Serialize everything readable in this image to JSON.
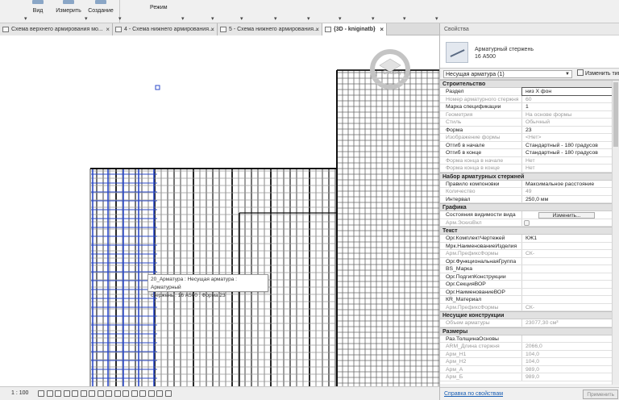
{
  "ribbon": {
    "buttons": [
      {
        "label": "Вид",
        "icon": "view-icon"
      },
      {
        "label": "Измерить",
        "icon": "measure-icon"
      },
      {
        "label": "Создание",
        "icon": "create-icon"
      },
      {
        "label": "Режим",
        "icon": "mode-icon"
      }
    ]
  },
  "tabs": [
    {
      "label": "Схема верхнего армирования мо...",
      "active": false
    },
    {
      "label": "4 - Схема нижнего армирования...",
      "active": false
    },
    {
      "label": "5 - Схема нижнего армирования...",
      "active": false
    },
    {
      "label": "{3D - kniginatb}",
      "active": true
    }
  ],
  "tab_close": "×",
  "viewcube_label": "Сверху",
  "tooltip": {
    "line1": "20_Арматура : Несущая арматура : Арматурный",
    "line2": "стержень : 16 А500 : Форма 23"
  },
  "status": {
    "scale": "1 : 100"
  },
  "properties": {
    "title": "Свойства",
    "type_name_line1": "Арматурный стержень",
    "type_name_line2": "16 А500",
    "instance_selector": "Несущая арматура (1)",
    "edit_type": "Изменить тип",
    "groups": [
      {
        "name": "Строительство",
        "rows": [
          {
            "name": "Раздел",
            "value": "низ Х фон",
            "disabled": false,
            "editing": true
          },
          {
            "name": "Номер арматурного стержня",
            "value": "60",
            "disabled": true
          },
          {
            "name": "Марка спецификации",
            "value": "1",
            "disabled": false
          },
          {
            "name": "Геометрия",
            "value": "На основе формы",
            "disabled": true
          },
          {
            "name": "Стиль",
            "value": "Обычный",
            "disabled": true
          },
          {
            "name": "Форма",
            "value": "23",
            "disabled": false
          },
          {
            "name": "Изображение формы",
            "value": "<Нет>",
            "disabled": true
          },
          {
            "name": "Отгиб в начале",
            "value": "Стандартный - 180 градусов",
            "disabled": false
          },
          {
            "name": "Отгиб в конце",
            "value": "Стандартный - 180 градусов",
            "disabled": false
          },
          {
            "name": "Форма конца в начале",
            "value": "Нет",
            "disabled": true
          },
          {
            "name": "Форма конца в конце",
            "value": "Нет",
            "disabled": true
          }
        ]
      },
      {
        "name": "Набор арматурных стержней",
        "rows": [
          {
            "name": "Правило компоновки",
            "value": "Максимальное расстояние",
            "disabled": false
          },
          {
            "name": "Количество",
            "value": "49",
            "disabled": true
          },
          {
            "name": "Интервал",
            "value": "250,0 мм",
            "disabled": false
          }
        ]
      },
      {
        "name": "Графика",
        "rows": [
          {
            "name": "Состояния видимости вида",
            "value": "",
            "button": "Изменить...",
            "disabled": false
          },
          {
            "name": "Арм.ЭскизВкл",
            "value": "",
            "checkbox": true,
            "disabled": true
          }
        ]
      },
      {
        "name": "Текст",
        "rows": [
          {
            "name": "Орг.КомплектЧертежей",
            "value": "КЖ1",
            "disabled": false
          },
          {
            "name": "Мрк.НаименованиеИзделия",
            "value": "",
            "disabled": false
          },
          {
            "name": "Арм.ПрефиксФормы",
            "value": "СК-",
            "disabled": true
          },
          {
            "name": "Орг.ФункциональнаяГруппа",
            "value": "",
            "disabled": false
          },
          {
            "name": "BS_Марка",
            "value": "",
            "disabled": false
          },
          {
            "name": "Орг.ПодгипКонструкции",
            "value": "",
            "disabled": false
          },
          {
            "name": "Орг.СекцияВОР",
            "value": "",
            "disabled": false
          },
          {
            "name": "Орг.НаименованиеВОР",
            "value": "",
            "disabled": false
          },
          {
            "name": "КR_Материал",
            "value": "",
            "disabled": false
          },
          {
            "name": "Арм.ПрефиксФормы",
            "value": "СК-",
            "disabled": true
          }
        ]
      },
      {
        "name": "Несущие конструкции",
        "rows": [
          {
            "name": "Объем арматуры",
            "value": "23077,30 см³",
            "disabled": true
          }
        ]
      },
      {
        "name": "Размеры",
        "rows": [
          {
            "name": "Раз.ТолщинаОсновы",
            "value": "",
            "disabled": false
          },
          {
            "name": "ARM_Длина стержня",
            "value": "2066,0",
            "disabled": true
          },
          {
            "name": "Арм_Н1",
            "value": "104,0",
            "disabled": true
          },
          {
            "name": "Арм_Н2",
            "value": "104,0",
            "disabled": true
          },
          {
            "name": "Арм_А",
            "value": "989,0",
            "disabled": true
          },
          {
            "name": "Арм_Б",
            "value": "989,0",
            "disabled": true
          }
        ]
      }
    ],
    "help_link": "Справка по свойствам",
    "apply": "Применить"
  }
}
